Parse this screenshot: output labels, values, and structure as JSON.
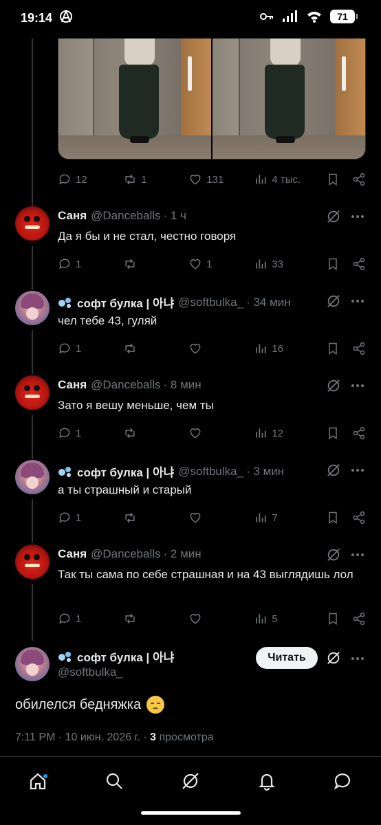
{
  "status_bar": {
    "time": "19:14",
    "battery": "71"
  },
  "top_post": {
    "replies": "12",
    "reposts": "1",
    "likes": "131",
    "views": "4 тыс."
  },
  "tweets": [
    {
      "name": "Саня",
      "handle": "@Danceballs",
      "time": "· 1 ч",
      "text": "Да я бы и не стал, честно говоря",
      "replies": "1",
      "reposts": "",
      "likes": "1",
      "views": "33"
    },
    {
      "name": "софт булка | 아냐",
      "handle": "@softbulka_",
      "time": "· 34 мин",
      "text": "чел тебе 43, гуляй",
      "replies": "1",
      "reposts": "",
      "likes": "",
      "views": "16"
    },
    {
      "name": "Саня",
      "handle": "@Danceballs",
      "time": "· 8 мин",
      "text": "Зато я вешу меньше, чем ты",
      "replies": "1",
      "reposts": "",
      "likes": "",
      "views": "12"
    },
    {
      "name": "софт булка | 아냐",
      "handle": "@softbulka_",
      "time": "· 3 мин",
      "text": "а ты страшный и старый",
      "replies": "1",
      "reposts": "",
      "likes": "",
      "views": "7"
    },
    {
      "name": "Саня",
      "handle": "@Danceballs",
      "time": "· 2 мин",
      "text": "Так ты сама по себе страшная и на 43 выглядишь лол",
      "replies": "1",
      "reposts": "",
      "likes": "",
      "views": "5"
    }
  ],
  "main_tweet": {
    "name": "софт булка | 아냐",
    "handle": "@softbulka_",
    "follow_label": "Читать",
    "text": "обилелся бедняжка",
    "timestamp": "7:11 PM · 10 июн. 2026 г. ·",
    "views_count": "3",
    "views_label": "просмотра"
  },
  "colors": {
    "background": "#000000",
    "muted": "#71767b",
    "text": "#e7e9ea",
    "accent": "#1d9bf0"
  }
}
